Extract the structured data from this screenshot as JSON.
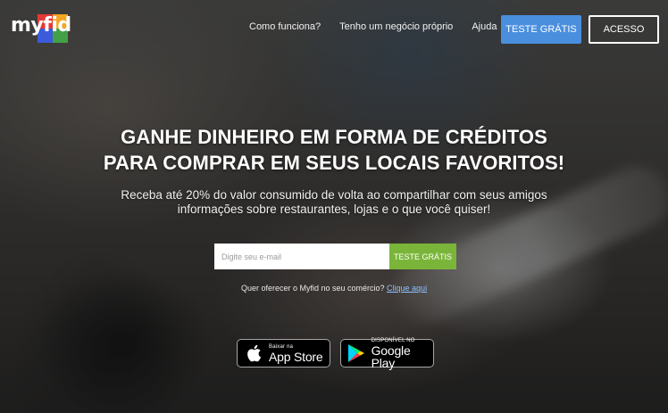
{
  "brand": {
    "logo_text": "myfid",
    "logo_colors": [
      "#e53935",
      "#f5a623",
      "#3b5bdb",
      "#43a047"
    ]
  },
  "nav": {
    "items": [
      {
        "label": "Como funciona?"
      },
      {
        "label": "Tenho um negócio próprio"
      },
      {
        "label": "Ajuda"
      }
    ],
    "trial_button": "TESTE GRÁTIS",
    "login_button": "ACESSO"
  },
  "hero": {
    "headline_line1": "GANHE DINHEIRO EM FORMA DE CRÉDITOS",
    "headline_line2": "PARA COMPRAR EM SEUS LOCAIS FAVORITOS!",
    "subtext_line1": "Receba até 20% do valor consumido de volta ao compartilhar com seus amigos",
    "subtext_line2": "informações sobre restaurantes, lojas e o que você quiser!"
  },
  "signup": {
    "email_placeholder": "Digite seu e-mail",
    "email_value": "",
    "submit_label": "TESTE GRÁTIS"
  },
  "business": {
    "text": "Quer oferecer o Myfid no seu comércio?",
    "link": "Clique aqui"
  },
  "stores": {
    "apple_small": "Baixar na",
    "apple_big": "App Store",
    "google_small": "DISPONÍVEL NO",
    "google_big": "Google Play"
  },
  "colors": {
    "accent_blue": "#4a8fde",
    "accent_green": "#7ab53a",
    "link_blue": "#8ec4ff"
  }
}
